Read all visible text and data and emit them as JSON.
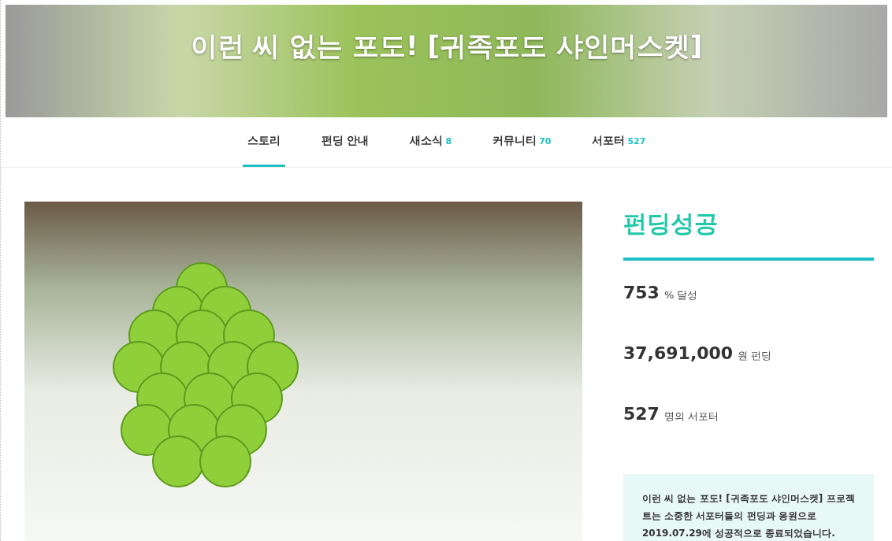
{
  "header": {
    "title": "이런 씨 없는 포도! [귀족포도 샤인머스켓]"
  },
  "tabs": [
    {
      "label": "스토리",
      "selected": true
    },
    {
      "label": "펀딩 안내",
      "selected": false
    },
    {
      "label": "새소식",
      "count": "8",
      "selected": false
    },
    {
      "label": "커뮤니티",
      "count": "70",
      "selected": false
    },
    {
      "label": "서포터",
      "count": "527",
      "selected": false
    }
  ],
  "status": {
    "title": "펀딩성공"
  },
  "stats": [
    {
      "value": "753",
      "unit": "% 달성"
    },
    {
      "value": "37,691,000",
      "unit": "원 펀딩"
    },
    {
      "value": "527",
      "unit": "명의 서포터"
    }
  ],
  "notice": "이런 씨 없는 포도! [귀족포도 샤인머스켓] 프로젝트는 소중한 서포터들의 펀딩과 응원으로 2019.07.29에 성공적으로 종료되었습니다."
}
